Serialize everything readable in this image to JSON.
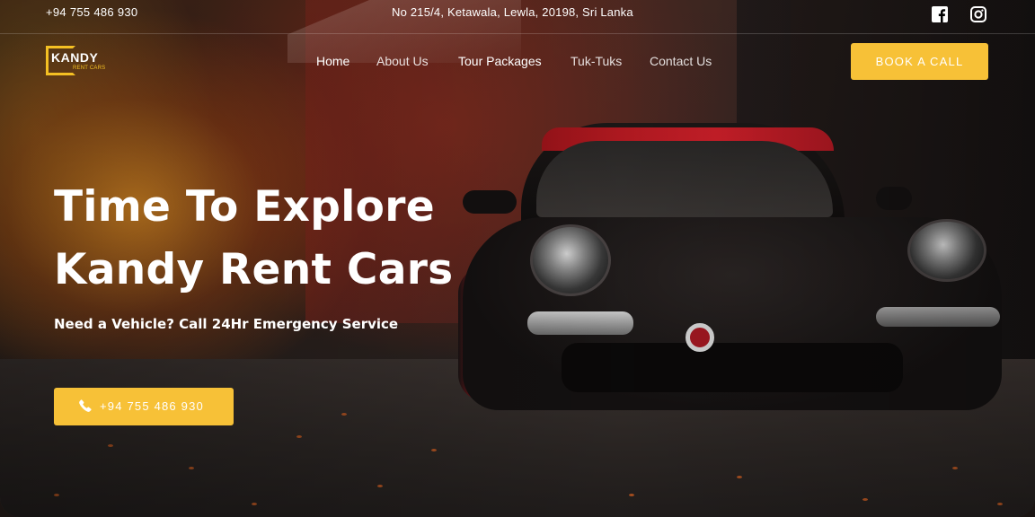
{
  "topbar": {
    "phone": "+94 755 486 930",
    "address": "No 215/4, Ketawala, Lewla, 20198, Sri Lanka",
    "social": [
      {
        "icon": "facebook-icon"
      },
      {
        "icon": "instagram-icon"
      }
    ]
  },
  "logo": {
    "name": "KANDY",
    "tagline": "RENT CARS"
  },
  "nav": {
    "items": [
      {
        "label": "Home",
        "active": true
      },
      {
        "label": "About Us",
        "active": false
      },
      {
        "label": "Tour Packages",
        "active": false
      },
      {
        "label": "Tuk-Tuks",
        "active": false
      },
      {
        "label": "Contact Us",
        "active": false
      }
    ],
    "cta_label": "BOOK A CALL"
  },
  "hero": {
    "headline_line1": "Time To Explore",
    "headline_line2": "Kandy Rent Cars",
    "subline": "Need a Vehicle? Call 24Hr Emergency Service",
    "call_button_label": "+94 755 486 930",
    "call_button_icon": "phone-icon"
  },
  "colors": {
    "accent": "#f7c137",
    "text": "#ffffff"
  }
}
